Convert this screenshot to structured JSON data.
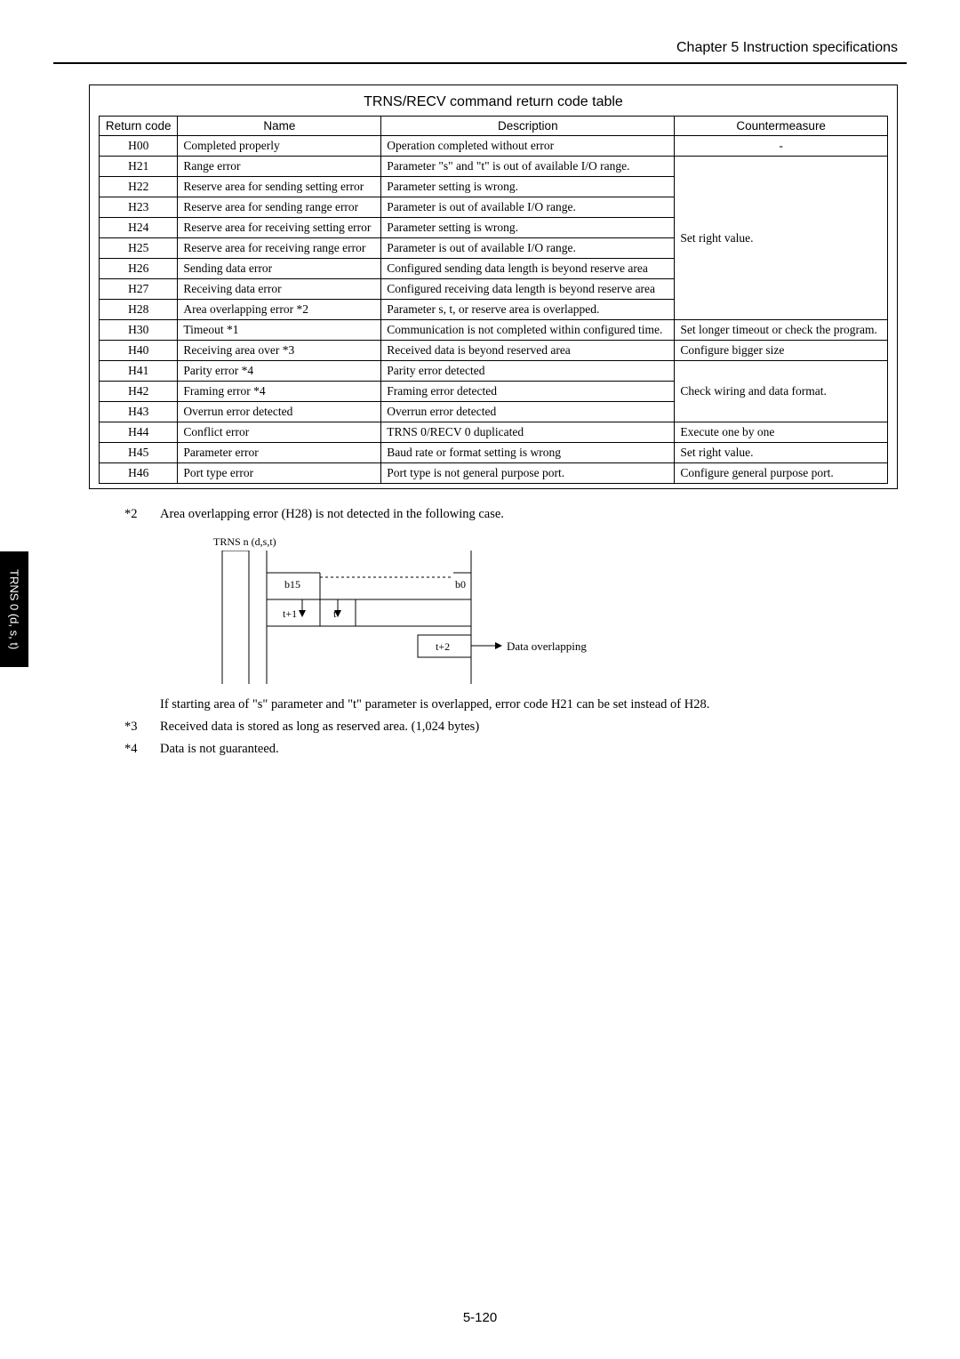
{
  "chapter": "Chapter 5   Instruction specifications",
  "side_tab": "TRNS 0 (d, s, t)",
  "table_title": "TRNS/RECV command return code table",
  "headers": {
    "return_code": "Return code",
    "name": "Name",
    "description": "Description",
    "countermeasure": "Countermeasure"
  },
  "rows": [
    {
      "code": "H00",
      "name": "Completed properly",
      "desc": "Operation completed without error",
      "cm": "-"
    },
    {
      "code": "H21",
      "name": "Range error",
      "desc": "Parameter \"s\" and \"t\" is out of available I/O range."
    },
    {
      "code": "H22",
      "name": "Reserve area for sending setting error",
      "desc": "Parameter setting is wrong."
    },
    {
      "code": "H23",
      "name": "Reserve area for sending range error",
      "desc": "Parameter is out of available I/O range."
    },
    {
      "code": "H24",
      "name": "Reserve area for receiving setting error",
      "desc": "Parameter setting is wrong."
    },
    {
      "code": "H25",
      "name": "Reserve area for receiving range error",
      "desc": "Parameter is out of available I/O range."
    },
    {
      "code": "H26",
      "name": "Sending data error",
      "desc": "Configured sending data length is beyond reserve area"
    },
    {
      "code": "H27",
      "name": "Receiving data error",
      "desc": "Configured receiving data length is beyond reserve area"
    },
    {
      "code": "H28",
      "name": "Area overlapping error *2",
      "desc": "Parameter s, t, or reserve area is overlapped."
    },
    {
      "code": "H30",
      "name": "Timeout *1",
      "desc": "Communication is not completed within configured time.",
      "cm": "Set longer timeout or check the program."
    },
    {
      "code": "H40",
      "name": "Receiving area over *3",
      "desc": "Received data is beyond reserved area",
      "cm": "Configure bigger size"
    },
    {
      "code": "H41",
      "name": "Parity error *4",
      "desc": "Parity error detected"
    },
    {
      "code": "H42",
      "name": "Framing error *4",
      "desc": "Framing error detected"
    },
    {
      "code": "H43",
      "name": "Overrun error detected",
      "desc": "Overrun error detected"
    },
    {
      "code": "H44",
      "name": "Conflict error",
      "desc": "TRNS 0/RECV 0 duplicated",
      "cm": "Execute one by one"
    },
    {
      "code": "H45",
      "name": "Parameter error",
      "desc": "Baud rate or format setting is wrong",
      "cm": "Set right value."
    },
    {
      "code": "H46",
      "name": "Port type error",
      "desc": "Port type is not general purpose port.",
      "cm": "Configure general purpose port."
    }
  ],
  "cm_group1": "Set right value.",
  "cm_group2": "Check wiring and data format.",
  "notes": {
    "n2_marker": "*2",
    "n2_text": "Area overlapping error (H28) is not detected in the following case.",
    "n2_followup": "If starting area of \"s\" parameter and \"t\" parameter is overlapped, error code H21 can be set instead of H28.",
    "n3_marker": "*3",
    "n3_text": "Received data is stored as long as reserved area. (1,024 bytes)",
    "n4_marker": "*4",
    "n4_text": "Data is not guaranteed."
  },
  "diagram": {
    "header_label": "TRNS n (d,s,t)",
    "b15": "b15",
    "b0": "b0",
    "t1": "t+1",
    "t": "t",
    "t2": "t+2",
    "overlap": "Data overlapping"
  },
  "page": "5-120"
}
